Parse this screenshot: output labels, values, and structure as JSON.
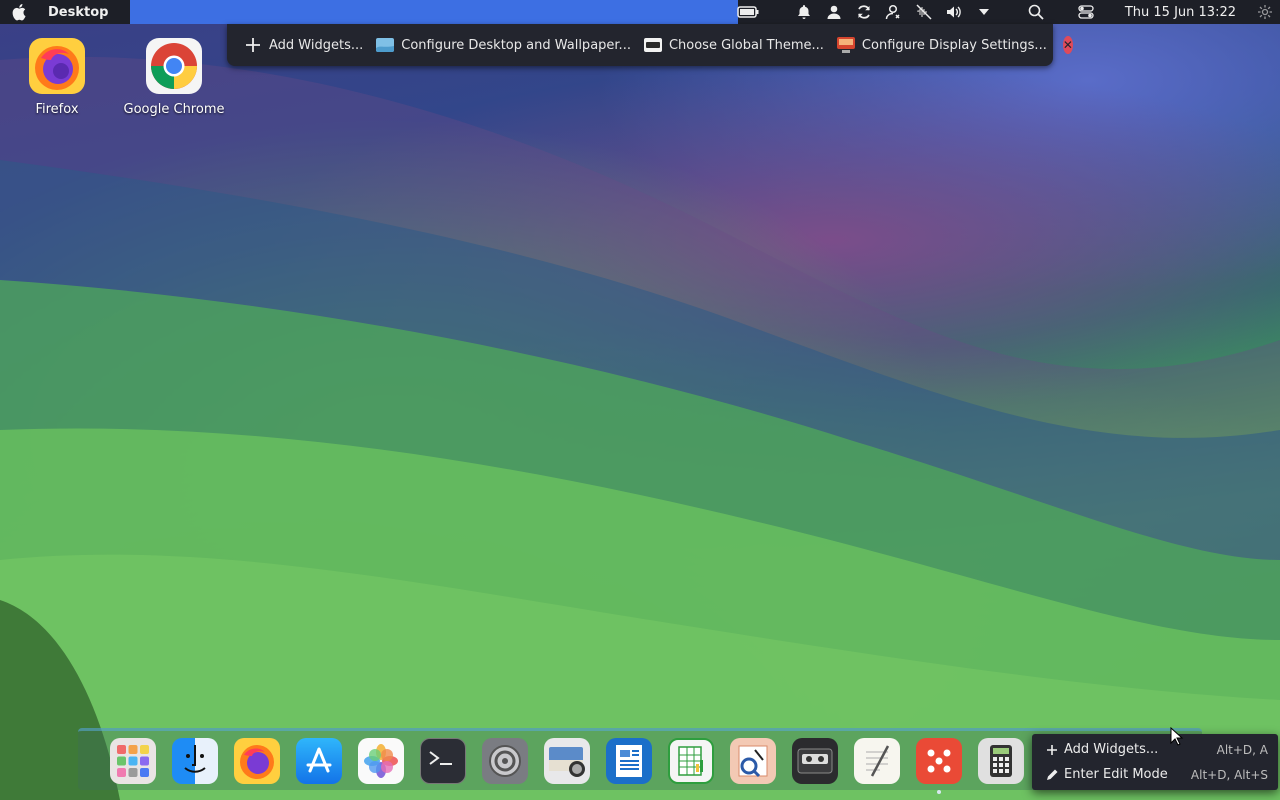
{
  "menubar": {
    "app_title": "Desktop",
    "clock": "Thu 15 Jun 13:22"
  },
  "edit_toolbar": {
    "add_widgets": "Add Widgets...",
    "configure_desktop": "Configure Desktop and Wallpaper...",
    "choose_theme": "Choose Global Theme...",
    "configure_display": "Configure Display Settings..."
  },
  "desktop_icons": [
    {
      "label": "Firefox"
    },
    {
      "label": "Google Chrome"
    }
  ],
  "context_menu": {
    "items": [
      {
        "label": "Add Widgets...",
        "shortcut": "Alt+D, A"
      },
      {
        "label": "Enter Edit Mode",
        "shortcut": "Alt+D, Alt+S"
      }
    ]
  },
  "colors": {
    "menubar_bg": "#1d1f27",
    "accent": "#3d6fe3",
    "close": "#e04a5a"
  }
}
